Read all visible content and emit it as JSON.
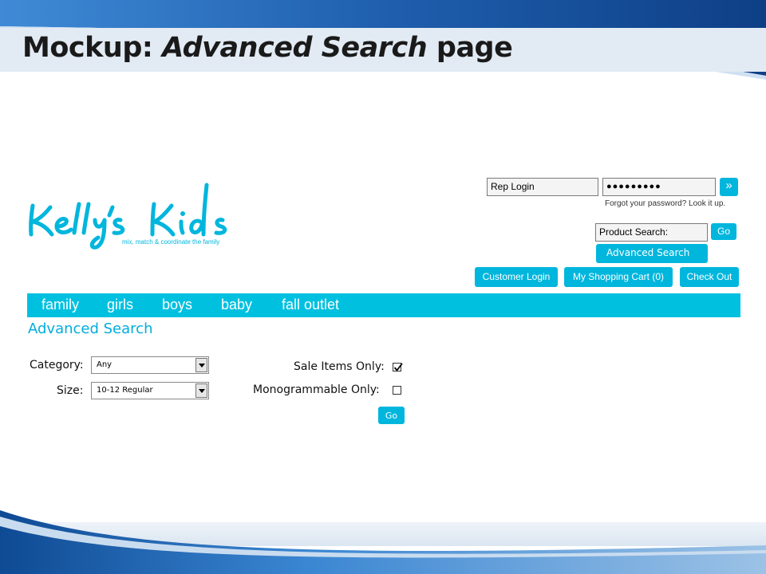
{
  "slide": {
    "title_prefix": "Mockup: ",
    "title_emphasis": "Advanced Search",
    "title_suffix": " page"
  },
  "brand": {
    "logo_name": "Kelly's Kids",
    "tagline": "mix, match & coordinate the family",
    "color": "#00b6dd"
  },
  "header": {
    "rep_login_value": "Rep Login",
    "password_value": "●●●●●●●●●",
    "submit_label": "»",
    "forgot_text": "Forgot your password? Look it up.",
    "product_search_value": "Product Search:",
    "go_label": "Go",
    "advanced_search_label": "Advanced Search",
    "customer_login_label": "Customer Login",
    "cart_label": "My Shopping Cart (0)",
    "checkout_label": "Check Out"
  },
  "nav": {
    "items": [
      "family",
      "girls",
      "boys",
      "baby",
      "fall outlet"
    ]
  },
  "form": {
    "heading": "Advanced Search",
    "category_label": "Category:",
    "category_value": "Any",
    "size_label": "Size:",
    "size_value": "10-12 Regular",
    "sale_label": "Sale Items Only:",
    "sale_checked": true,
    "mono_label": "Monogrammable Only:",
    "mono_checked": false,
    "go_label": "Go"
  }
}
